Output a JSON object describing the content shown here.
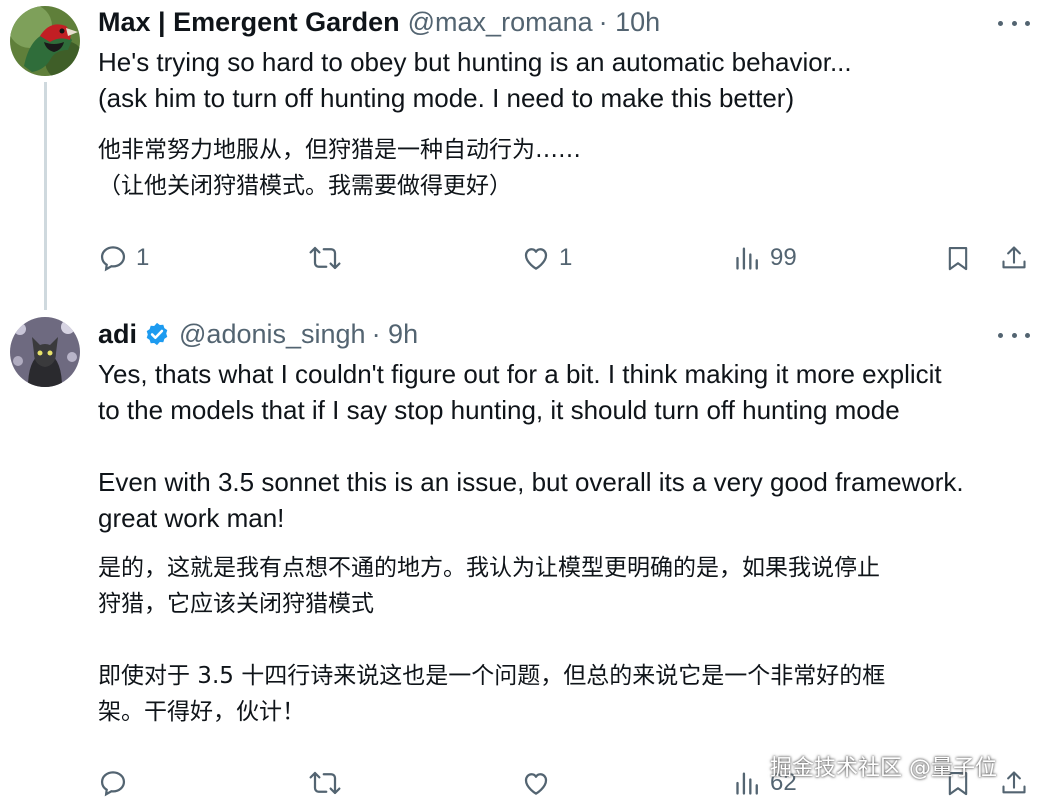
{
  "tweets": [
    {
      "author_name": "Max | Emergent Garden",
      "handle": "@max_romana",
      "time": "· 10h",
      "verified": false,
      "text_en": [
        "He's trying so hard to obey but hunting is an automatic behavior...",
        "(ask him to turn off hunting mode. I need to make this better)"
      ],
      "text_zh": [
        "他非常努力地服从，但狩猎是一种自动行为……",
        "（让他关闭狩猎模式。我需要做得更好）"
      ],
      "actions": {
        "replies": "1",
        "retweets": "",
        "likes": "1",
        "views": "99"
      }
    },
    {
      "author_name": "adi",
      "handle": "@adonis_singh",
      "time": "· 9h",
      "verified": true,
      "text_en": [
        "Yes, thats what I couldn't figure out for a bit. I think making it more explicit",
        "to the models that if I say stop hunting, it should turn off hunting mode",
        "Even with 3.5 sonnet this is an issue, but overall its a very good framework.",
        "great work man!"
      ],
      "text_zh": [
        "是的，这就是我有点想不通的地方。我认为让模型更明确的是，如果我说停止",
        "狩猎，它应该关闭狩猎模式",
        "即使对于 3.5 十四行诗来说这也是一个问题，但总的来说它是一个非常好的框",
        "架。干得好，伙计！"
      ],
      "actions": {
        "replies": "",
        "retweets": "",
        "likes": "",
        "views": "62"
      }
    }
  ],
  "icons": {
    "reply": "reply-icon",
    "retweet": "retweet-icon",
    "like": "like-icon",
    "views": "views-icon",
    "bookmark": "bookmark-icon",
    "share": "share-icon",
    "more": "more-icon",
    "verified": "verified-badge-icon"
  },
  "colors": {
    "text": "#0f1419",
    "secondary": "#536471",
    "verified": "#1d9bf0",
    "thread_line": "#cfd9de"
  },
  "watermark": "掘金技术社区 @量子位"
}
